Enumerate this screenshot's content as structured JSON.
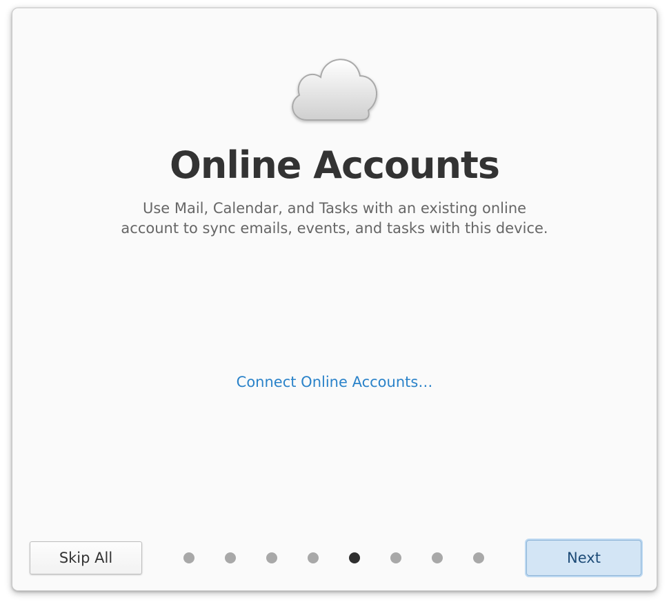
{
  "onboarding": {
    "title": "Online Accounts",
    "description_lines": [
      "Use Mail, Calendar, and Tasks with an existing online",
      "account to sync emails, events, and tasks with this device."
    ],
    "connect_link": "Connect Online Accounts…",
    "icon": "cloud-icon"
  },
  "footer": {
    "skip_label": "Skip All",
    "next_label": "Next",
    "page_count": 8,
    "current_page": 5
  },
  "colors": {
    "accent": "#2a82c9",
    "title": "#333333",
    "description": "#666666",
    "dot_inactive": "#a8a8a8",
    "dot_active": "#2f2f2f",
    "next_bg": "#d3e5f5"
  }
}
